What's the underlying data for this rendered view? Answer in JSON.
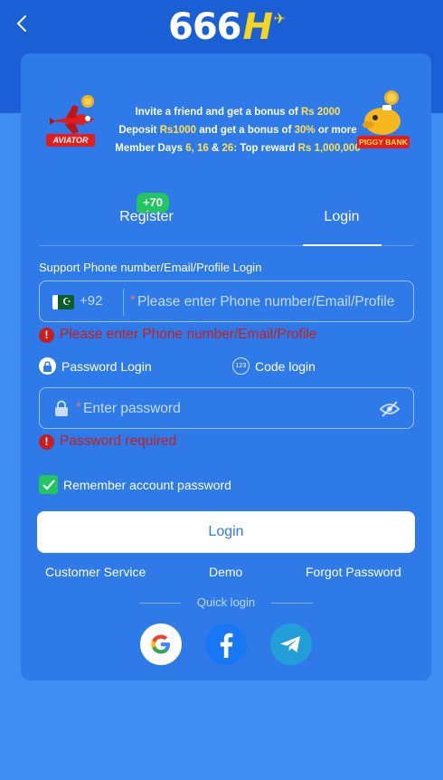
{
  "header": {
    "logo_text": "666",
    "logo_h": "H"
  },
  "banner": {
    "line1_pre": "Invite a friend and get a bonus of ",
    "line1_hl": "Rs 2000",
    "line2_a": "Deposit ",
    "line2_hl1": "Rs1000",
    "line2_b": " and get a bonus of ",
    "line2_hl2": "30%",
    "line2_c": " or more",
    "line3_a": "Member Days ",
    "line3_hl1": "6, 16",
    "line3_b": " & ",
    "line3_hl2": "26",
    "line3_c": ": Top reward ",
    "line3_hl3": "Rs 1,000,000",
    "left_tag": "AVIATOR",
    "right_tag": "PIGGY BANK"
  },
  "tabs": {
    "register": "Register",
    "login": "Login",
    "register_badge": "+70"
  },
  "form": {
    "support_label": "Support Phone number/Email/Profile Login",
    "country_code": "+92",
    "phone_placeholder": "Please enter Phone number/Email/Profile",
    "phone_error": "Please enter Phone number/Email/Profile",
    "password_login": "Password Login",
    "code_login": "Code login",
    "code_icon_text": "123",
    "password_placeholder": "Enter password",
    "password_error": "Password required",
    "required_mark": "*",
    "remember": "Remember account password",
    "login_button": "Login"
  },
  "links": {
    "customer_service": "Customer Service",
    "demo": "Demo",
    "forgot": "Forgot Password"
  },
  "quick_login": {
    "label": "Quick login",
    "providers": [
      "google-icon",
      "facebook-icon",
      "telegram-icon"
    ]
  },
  "colors": {
    "background": "#3f8cf3",
    "top_band": "#1a5fd6",
    "card": "#2e7ae8",
    "error": "#c81e1e",
    "highlight": "#ffe14d",
    "success": "#22c55e"
  }
}
